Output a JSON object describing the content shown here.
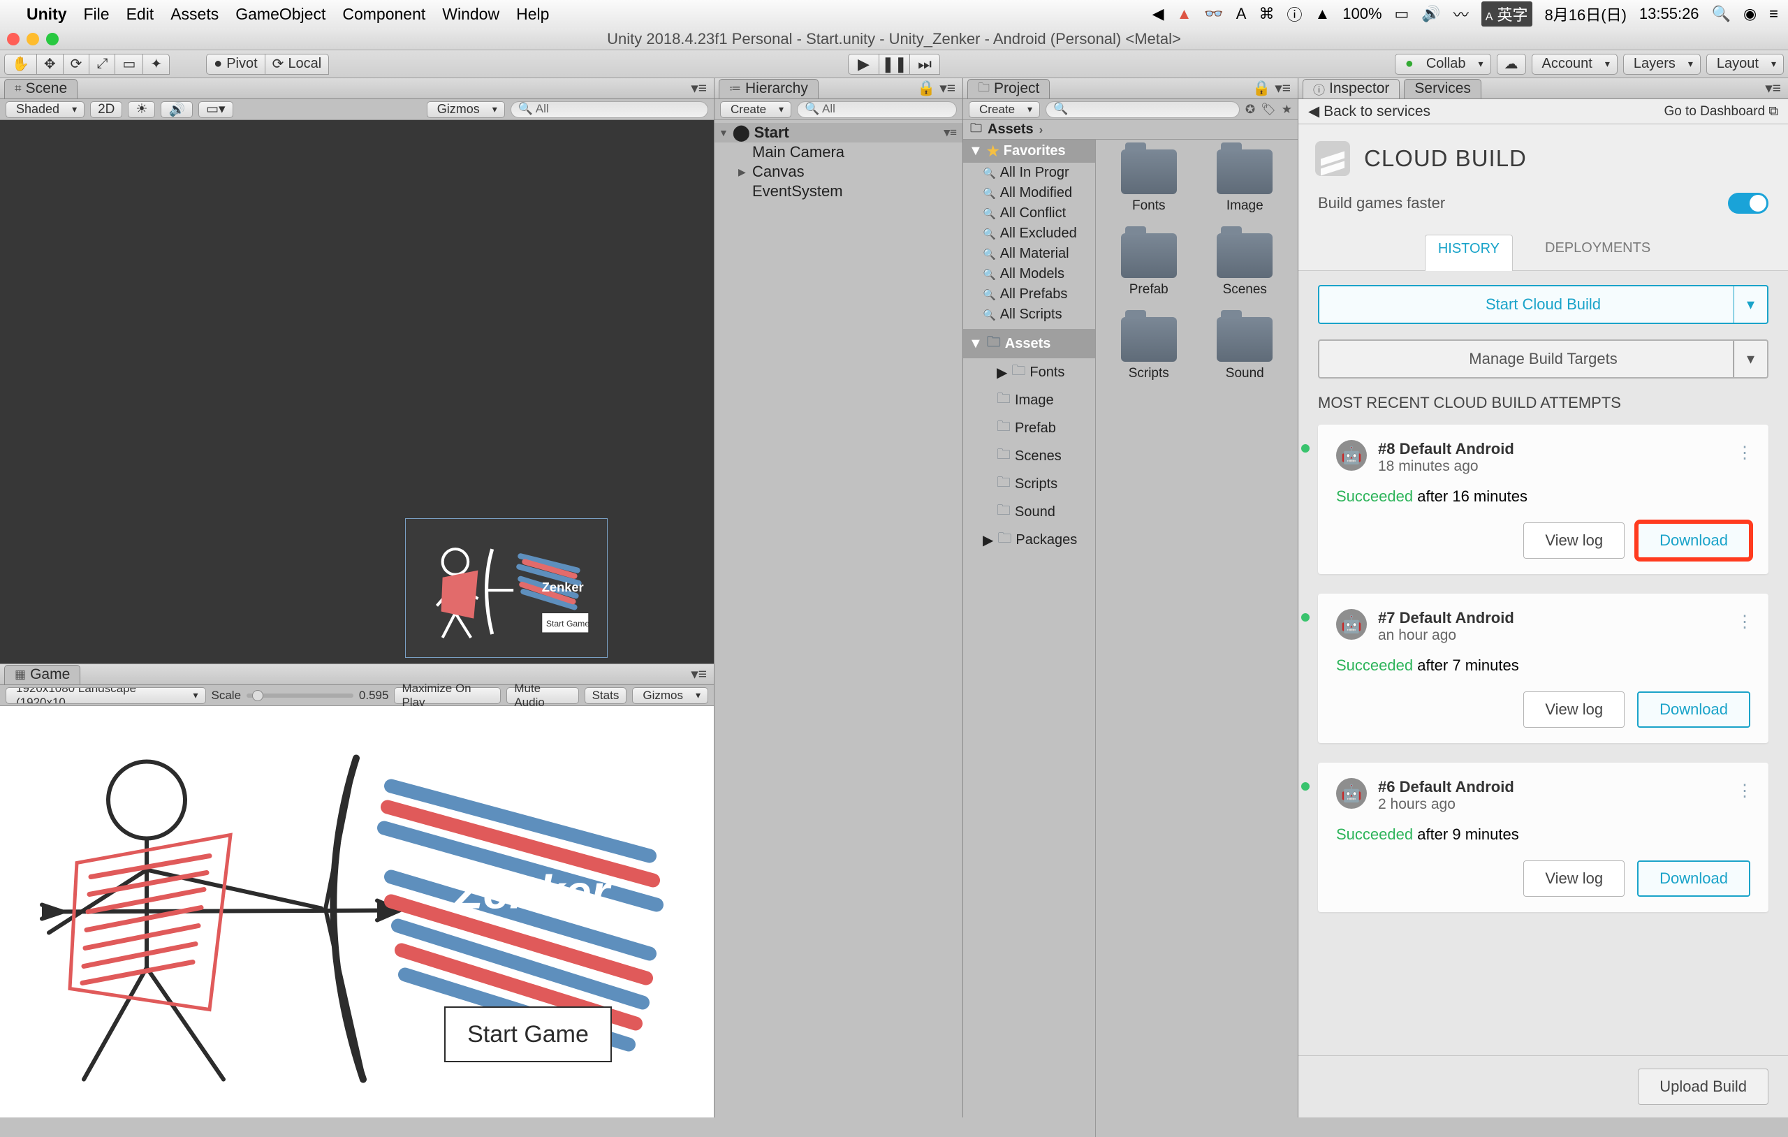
{
  "mac_menu": {
    "app": "Unity",
    "items": [
      "File",
      "Edit",
      "Assets",
      "GameObject",
      "Component",
      "Window",
      "Help"
    ],
    "status": {
      "battery": "100%",
      "ime": "英字",
      "date": "8月16日(日)",
      "time": "13:55:26"
    }
  },
  "window_title": "Unity 2018.4.23f1 Personal - Start.unity - Unity_Zenker - Android (Personal) <Metal>",
  "toolbar": {
    "pivot": "Pivot",
    "local": "Local",
    "collab": "Collab",
    "account": "Account",
    "layers": "Layers",
    "layout": "Layout"
  },
  "scene": {
    "tab": "Scene",
    "shaded": "Shaded",
    "twod": "2D",
    "gizmos": "Gizmos",
    "search_placeholder": "All"
  },
  "game": {
    "tab": "Game",
    "res": "1920x1080 Landscape (1920x10",
    "scale_label": "Scale",
    "scale_value": "0.595",
    "opts": [
      "Maximize On Play",
      "Mute Audio",
      "Stats",
      "Gizmos"
    ],
    "title": "Zenker",
    "start_button": "Start Game"
  },
  "hierarchy": {
    "tab": "Hierarchy",
    "create": "Create",
    "root": "Start",
    "children": [
      "Main Camera",
      "Canvas",
      "EventSystem"
    ]
  },
  "project": {
    "tab": "Project",
    "create": "Create",
    "crumb_root": "Assets",
    "favorites": {
      "label": "Favorites",
      "items": [
        "All In Progr",
        "All Modified",
        "All Conflict",
        "All Excluded",
        "All Material",
        "All Models",
        "All Prefabs",
        "All Scripts"
      ]
    },
    "assets": {
      "label": "Assets",
      "children": [
        "Fonts",
        "Image",
        "Prefab",
        "Scenes",
        "Scripts",
        "Sound"
      ],
      "packages": "Packages"
    },
    "folders": [
      "Fonts",
      "Image",
      "Prefab",
      "Scenes",
      "Scripts",
      "Sound"
    ]
  },
  "services": {
    "inspector_tab": "Inspector",
    "services_tab": "Services",
    "back": "Back to services",
    "dashboard": "Go to Dashboard",
    "title": "CLOUD BUILD",
    "tagline": "Build games faster",
    "tabs": {
      "history": "HISTORY",
      "deployments": "DEPLOYMENTS"
    },
    "start_build": "Start Cloud Build",
    "manage_targets": "Manage Build Targets",
    "section": "MOST RECENT CLOUD BUILD ATTEMPTS",
    "view_log": "View log",
    "download": "Download",
    "upload": "Upload Build",
    "builds": [
      {
        "name": "#8 Default Android",
        "age": "18 minutes ago",
        "status": "Succeeded",
        "duration": "after 16 minutes"
      },
      {
        "name": "#7 Default Android",
        "age": "an hour ago",
        "status": "Succeeded",
        "duration": "after 7 minutes"
      },
      {
        "name": "#6 Default Android",
        "age": "2 hours ago",
        "status": "Succeeded",
        "duration": "after 9 minutes"
      }
    ]
  }
}
